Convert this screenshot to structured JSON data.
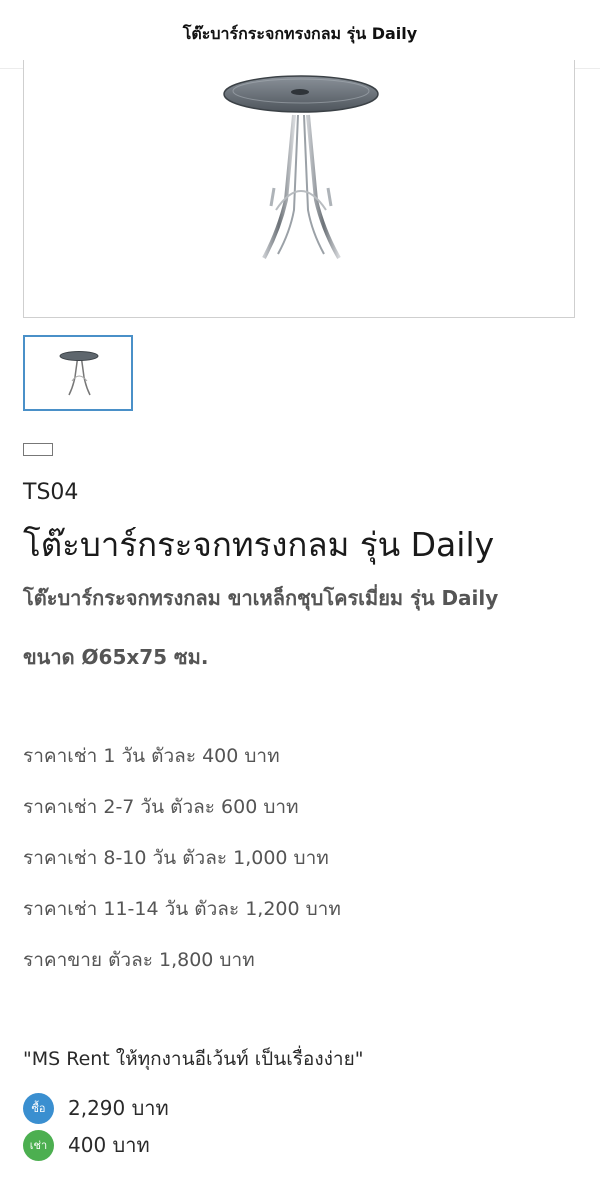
{
  "header": {
    "title": "โต๊ะบาร์กระจกทรงกลม รุ่น Daily"
  },
  "product": {
    "sku": "TS04",
    "title": "โต๊ะบาร์กระจกทรงกลม รุ่น Daily",
    "subtitle": "โต๊ะบาร์กระจกทรงกลม ขาเหล็กชุบโครเมี่ยม รุ่น Daily",
    "size": "ขนาด Ø65x75 ซม."
  },
  "prices": [
    "ราคาเช่า 1 วัน ตัวละ 400 บาท",
    "ราคาเช่า 2-7 วัน ตัวละ 600 บาท",
    "ราคาเช่า 8-10 วัน ตัวละ 1,000 บาท",
    "ราคาเช่า 11-14 วัน ตัวละ 1,200 บาท",
    "ราคาขาย ตัวละ 1,800 บาท"
  ],
  "slogan": "\"MS Rent ให้ทุกงานอีเว้นท์ เป็นเรื่องง่าย\"",
  "offers": [
    {
      "badge": "ซื้อ",
      "amount": "2,290 บาท",
      "color": "#3a8fd0"
    },
    {
      "badge": "เช่า",
      "amount": "400 บาท",
      "color": "#4caf50"
    }
  ],
  "colors": {
    "thumb_border": "#4a90c8",
    "text_gray": "#555555"
  }
}
